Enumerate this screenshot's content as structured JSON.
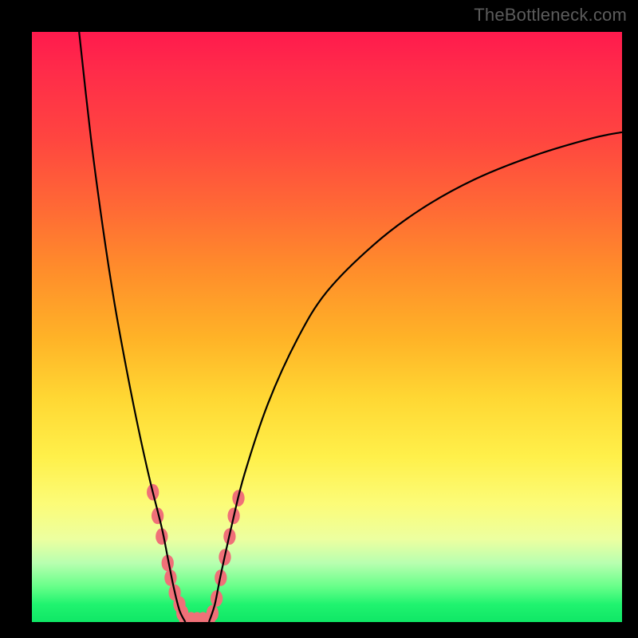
{
  "watermark": "TheBottleneck.com",
  "chart_data": {
    "type": "line",
    "title": "",
    "xlabel": "",
    "ylabel": "",
    "xlim": [
      0,
      100
    ],
    "ylim": [
      0,
      100
    ],
    "gradient_stops": [
      {
        "pos": 0,
        "color": "#ff1a4d"
      },
      {
        "pos": 18,
        "color": "#ff4540"
      },
      {
        "pos": 40,
        "color": "#ff8c2b"
      },
      {
        "pos": 62,
        "color": "#ffd733"
      },
      {
        "pos": 80,
        "color": "#fcfc78"
      },
      {
        "pos": 90,
        "color": "#b8ffb0"
      },
      {
        "pos": 100,
        "color": "#0fe766"
      }
    ],
    "series": [
      {
        "name": "left-curve",
        "color": "#000000",
        "points": [
          {
            "x": 8,
            "y": 100
          },
          {
            "x": 10,
            "y": 82
          },
          {
            "x": 12,
            "y": 67
          },
          {
            "x": 14,
            "y": 54
          },
          {
            "x": 16,
            "y": 43
          },
          {
            "x": 18,
            "y": 33
          },
          {
            "x": 20,
            "y": 24
          },
          {
            "x": 22,
            "y": 16
          },
          {
            "x": 23,
            "y": 11
          },
          {
            "x": 24,
            "y": 6
          },
          {
            "x": 25,
            "y": 2
          },
          {
            "x": 26,
            "y": 0
          }
        ]
      },
      {
        "name": "right-curve",
        "color": "#000000",
        "points": [
          {
            "x": 30,
            "y": 0
          },
          {
            "x": 31,
            "y": 3
          },
          {
            "x": 32,
            "y": 8
          },
          {
            "x": 34,
            "y": 17
          },
          {
            "x": 36,
            "y": 25
          },
          {
            "x": 40,
            "y": 37
          },
          {
            "x": 45,
            "y": 48
          },
          {
            "x": 50,
            "y": 56
          },
          {
            "x": 58,
            "y": 64
          },
          {
            "x": 66,
            "y": 70
          },
          {
            "x": 75,
            "y": 75
          },
          {
            "x": 85,
            "y": 79
          },
          {
            "x": 95,
            "y": 82
          },
          {
            "x": 100,
            "y": 83
          }
        ]
      }
    ],
    "highlight_markers": {
      "color": "#f07078",
      "radius_px": 9,
      "points": [
        {
          "x": 20.5,
          "y": 22
        },
        {
          "x": 21.3,
          "y": 18
        },
        {
          "x": 22.0,
          "y": 14.5
        },
        {
          "x": 23.0,
          "y": 10
        },
        {
          "x": 23.5,
          "y": 7.5
        },
        {
          "x": 24.2,
          "y": 5
        },
        {
          "x": 25.0,
          "y": 3
        },
        {
          "x": 25.5,
          "y": 1.5
        },
        {
          "x": 26.0,
          "y": 0.3
        },
        {
          "x": 27.0,
          "y": 0.3
        },
        {
          "x": 28.0,
          "y": 0.3
        },
        {
          "x": 29.0,
          "y": 0.3
        },
        {
          "x": 30.0,
          "y": 0.3
        },
        {
          "x": 30.6,
          "y": 1.5
        },
        {
          "x": 31.3,
          "y": 4
        },
        {
          "x": 32.0,
          "y": 7.5
        },
        {
          "x": 32.7,
          "y": 11
        },
        {
          "x": 33.5,
          "y": 14.5
        },
        {
          "x": 34.2,
          "y": 18
        },
        {
          "x": 35.0,
          "y": 21
        }
      ]
    }
  }
}
